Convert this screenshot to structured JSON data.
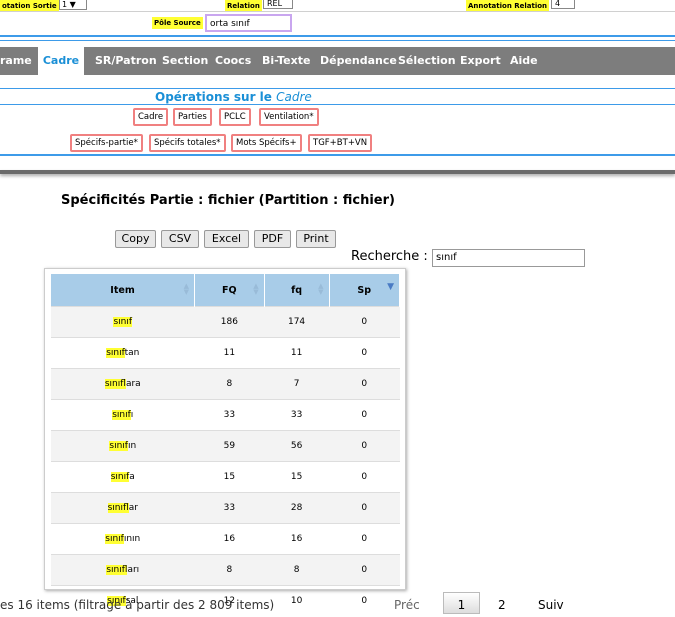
{
  "top_form": {
    "annotation_sortie_label": "otation Sortie",
    "annotation_sortie_value": "1 ▼",
    "relation_label": "Relation",
    "relation_value": "REL",
    "annotation_relation_label": "Annotation Relation",
    "annotation_relation_value": "4",
    "pole_source_label": "Pôle Source",
    "pole_source_value": "orta sınıf"
  },
  "menu": {
    "items": [
      {
        "label": "rame"
      },
      {
        "label": "Cadre"
      },
      {
        "label": "SR/Patron"
      },
      {
        "label": "Section"
      },
      {
        "label": "Coocs"
      },
      {
        "label": "Bi-Texte"
      },
      {
        "label": "Dépendance"
      },
      {
        "label": "Sélection"
      },
      {
        "label": "Export"
      },
      {
        "label": "Aide"
      }
    ],
    "active": "Cadre"
  },
  "operations": {
    "title_prefix": "Opérations sur le ",
    "title_emph": "Cadre",
    "row1": [
      "Cadre",
      "Parties",
      "PCLC",
      "Ventilation*"
    ],
    "row2": [
      "Spécifs-partie*",
      "Spécifs totales*",
      "Mots Spécifs+",
      "TGF+BT+VN"
    ]
  },
  "results": {
    "heading": "Spécificités Partie : fichier (Partition : fichier)",
    "export_buttons": [
      "Copy",
      "CSV",
      "Excel",
      "PDF",
      "Print"
    ],
    "search_label": "Recherche :",
    "search_value": "sınıf",
    "columns": [
      "Item",
      "FQ",
      "fq",
      "Sp"
    ],
    "rows": [
      {
        "item": "sınıf",
        "hl": "sınıf",
        "rest": "",
        "FQ": "186",
        "fq": "174",
        "Sp": "0"
      },
      {
        "item": "sınıftan",
        "hl": "sınıf",
        "rest": "tan",
        "FQ": "11",
        "fq": "11",
        "Sp": "0"
      },
      {
        "item": "sınıflara",
        "hl": "sınıf",
        "rest": "lara",
        "FQ": "8",
        "fq": "7",
        "Sp": "0"
      },
      {
        "item": "sınıfı",
        "hl": "sınıf",
        "rest": "ı",
        "FQ": "33",
        "fq": "33",
        "Sp": "0"
      },
      {
        "item": "sınıfın",
        "hl": "sınıf",
        "rest": "ın",
        "FQ": "59",
        "fq": "56",
        "Sp": "0"
      },
      {
        "item": "sınıfa",
        "hl": "sınıf",
        "rest": "a",
        "FQ": "15",
        "fq": "15",
        "Sp": "0"
      },
      {
        "item": "sınıflar",
        "hl": "sınıf",
        "rest": "lar",
        "FQ": "33",
        "fq": "28",
        "Sp": "0"
      },
      {
        "item": "sınıfının",
        "hl": "sınıf",
        "rest": "ının",
        "FQ": "16",
        "fq": "16",
        "Sp": "0"
      },
      {
        "item": "sınıfları",
        "hl": "sınıf",
        "rest": "ları",
        "FQ": "8",
        "fq": "8",
        "Sp": "0"
      },
      {
        "item": "sınıfsal",
        "hl": "sınıf",
        "rest": "sal",
        "FQ": "12",
        "fq": "10",
        "Sp": "0"
      }
    ],
    "info": "es 16 items (filtrage à partir des 2 809 items)",
    "pagination": {
      "prev": "Préc",
      "page1": "1",
      "page2": "2",
      "next": "Suiv"
    }
  },
  "colors": {
    "highlight": "#ffff33",
    "menu_bg": "#7d7d7d",
    "accent": "#1a8fd6",
    "op_border": "#f08080",
    "table_header": "#a8cce8"
  }
}
